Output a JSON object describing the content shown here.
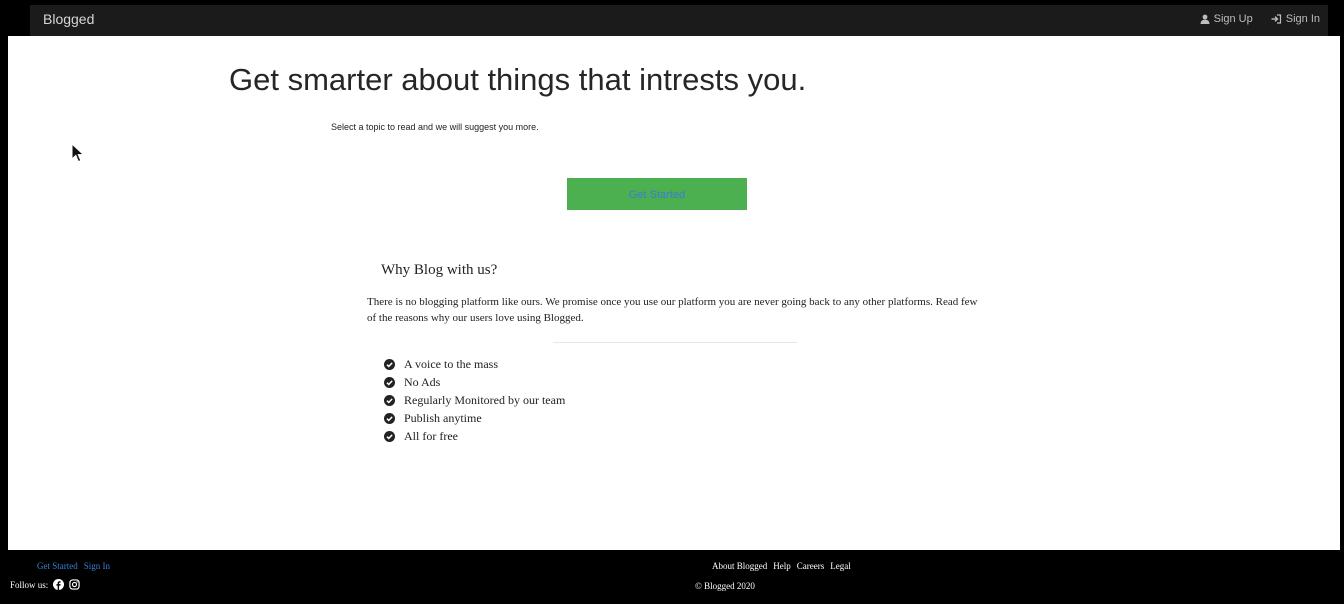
{
  "navbar": {
    "brand": "Blogged",
    "sign_up": "Sign Up",
    "sign_in": "Sign In"
  },
  "hero": {
    "title": "Get smarter about things that intrests you.",
    "subtitle": "Select a topic to read and we will suggest you more.",
    "cta_label": "Get Started"
  },
  "why": {
    "title": "Why Blog with us?",
    "body": "There is no blogging platform like ours. We promise once you use our platform you are never going back to any other platforms. Read few of the reasons why our users love using Blogged.",
    "features": [
      "A voice to the mass",
      "No Ads",
      "Regularly Monitored by our team",
      "Publish anytime",
      "All for free"
    ]
  },
  "footer": {
    "get_started": "Get Started",
    "sign_in": "Sign In",
    "follow_us": "Follow us:",
    "links": [
      "About Blogged",
      "Help",
      "Careers",
      "Legal"
    ],
    "copyright": "© Blogged 2020"
  },
  "colors": {
    "navbar_bg": "#1b1b1b",
    "cta_bg": "#4caf50",
    "cta_text": "#3b7fd1",
    "footer_link": "#3b7fd1"
  },
  "icons": {
    "sign_up": "user-icon",
    "sign_in": "sign-in-icon",
    "feature": "check-circle-icon",
    "facebook": "facebook-icon",
    "instagram": "instagram-icon"
  }
}
